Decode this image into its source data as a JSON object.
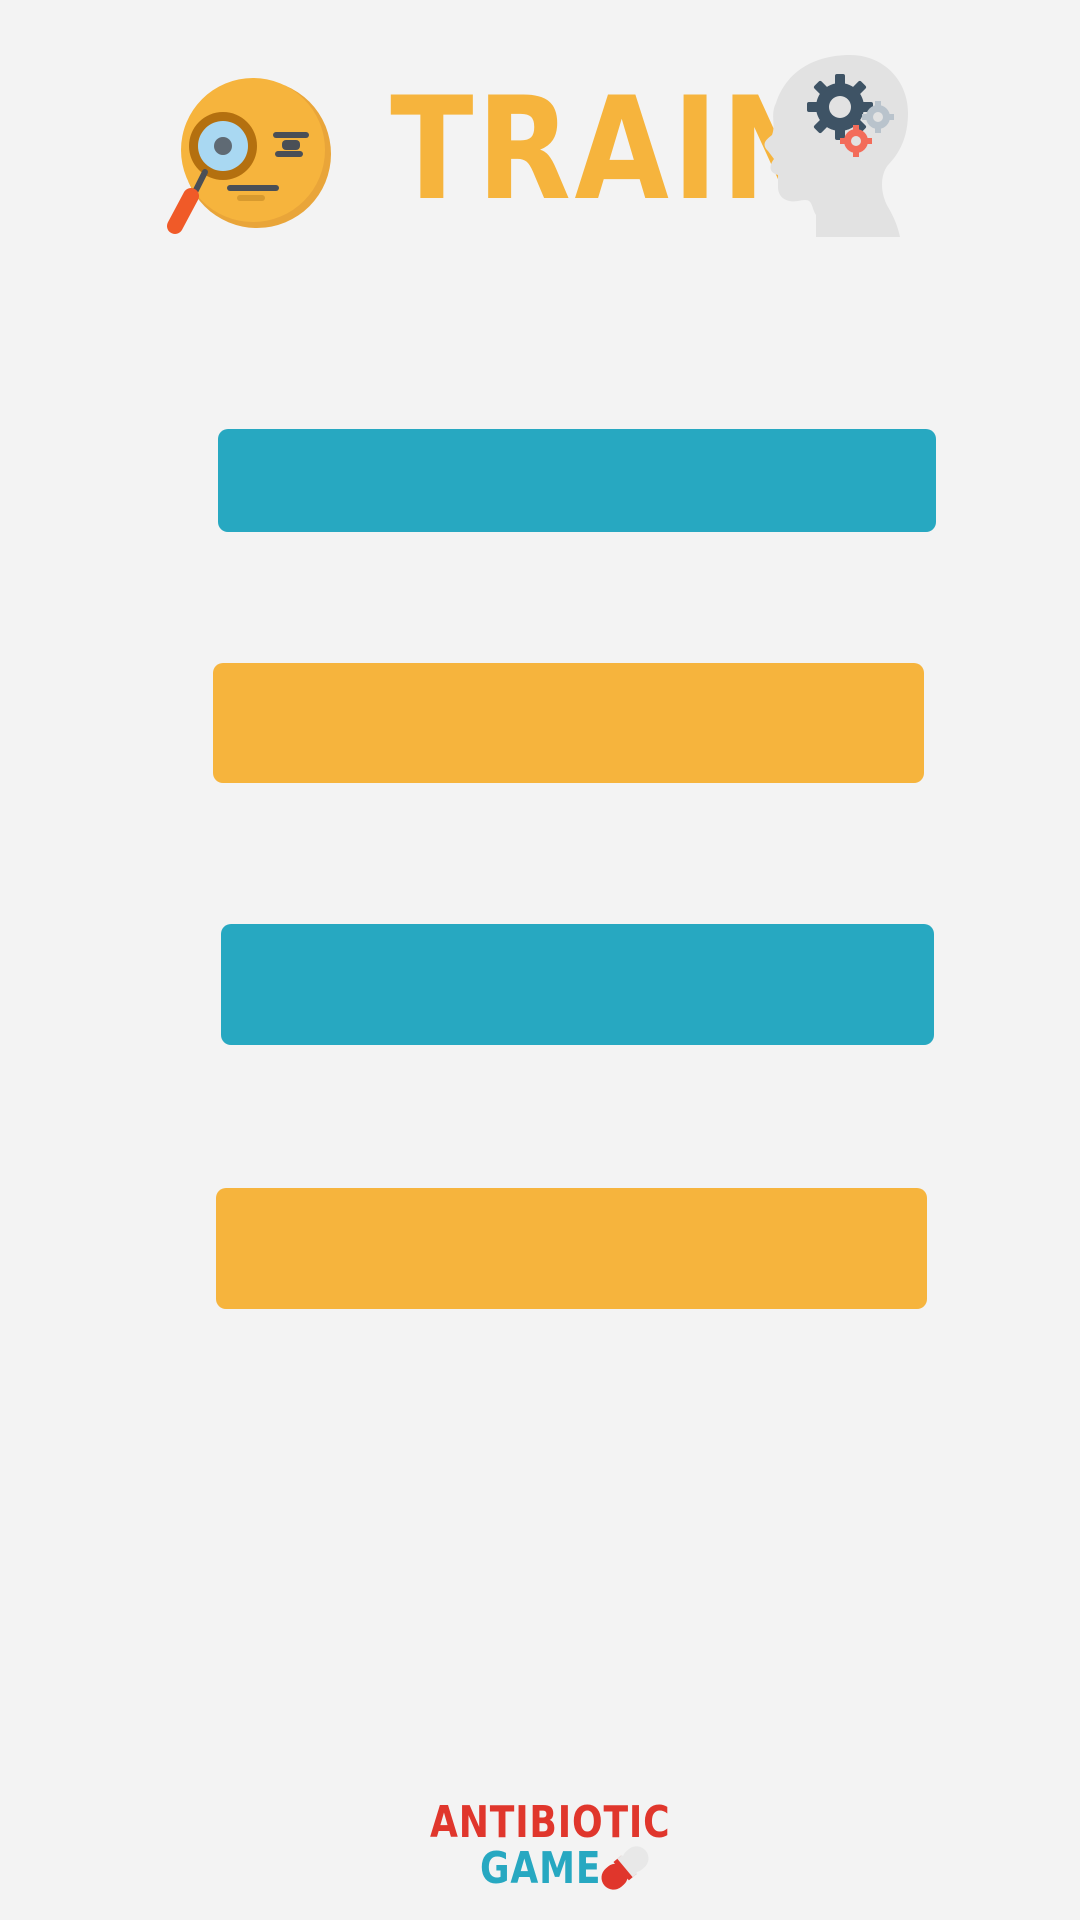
{
  "header": {
    "title": "TRAIN",
    "left_icon": "monocle-face-icon",
    "right_icon": "brain-gears-icon"
  },
  "menu": {
    "buttons": [
      {
        "label": "",
        "color": "#27a8c1"
      },
      {
        "label": "",
        "color": "#f6b43d"
      },
      {
        "label": "",
        "color": "#27a8c1"
      },
      {
        "label": "",
        "color": "#f6b43d"
      }
    ]
  },
  "footer": {
    "logo_line1": "ANTIBIOTIC",
    "logo_line2": "GAME",
    "logo_icon": "pill-icon"
  },
  "colors": {
    "background": "#f3f3f3",
    "accent_orange": "#f6b43d",
    "accent_blue": "#27a8c1",
    "logo_red": "#e0362c"
  }
}
